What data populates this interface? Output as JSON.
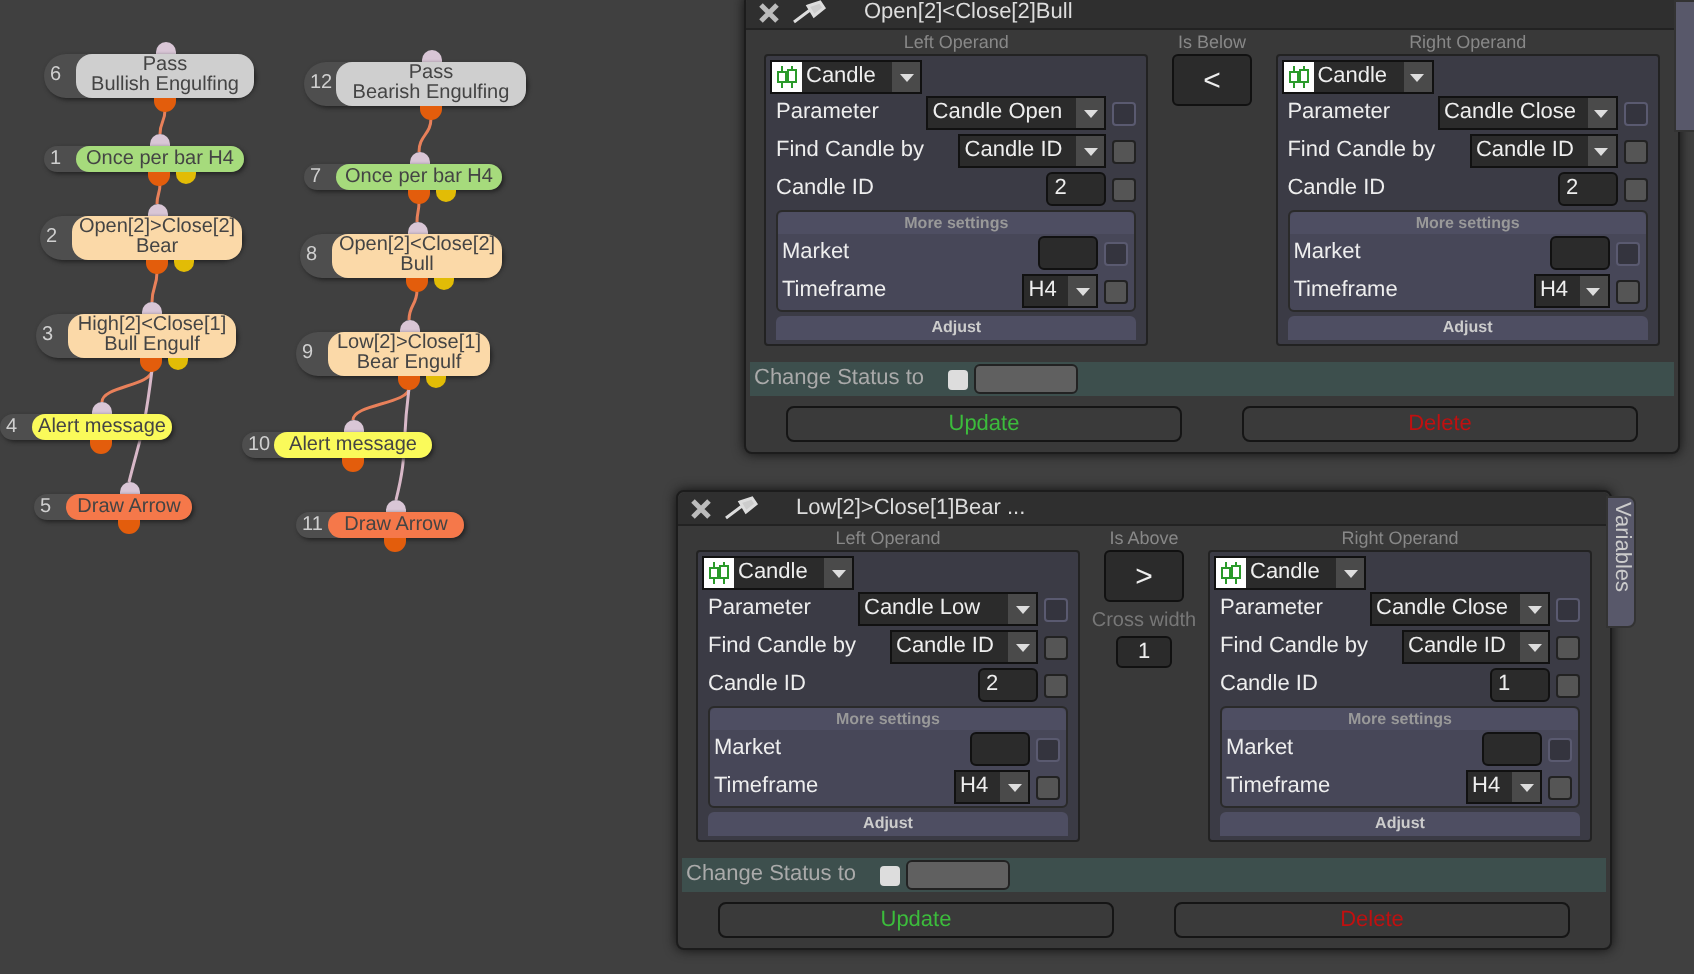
{
  "nodes": [
    {
      "number": "6",
      "kind": "pass",
      "lines": [
        "Pass",
        "Bullish Engulfing"
      ]
    },
    {
      "number": "1",
      "kind": "once",
      "lines": [
        "Once per bar H4"
      ]
    },
    {
      "number": "2",
      "kind": "condition",
      "lines": [
        "Open[2]>Close[2]",
        "Bear"
      ]
    },
    {
      "number": "3",
      "kind": "condition",
      "lines": [
        "High[2]<Close[1]",
        "Bull Engulf"
      ]
    },
    {
      "number": "4",
      "kind": "alert",
      "lines": [
        "Alert message"
      ]
    },
    {
      "number": "5",
      "kind": "arrow",
      "lines": [
        "Draw Arrow"
      ]
    },
    {
      "number": "12",
      "kind": "pass",
      "lines": [
        "Pass",
        "Bearish Engulfing"
      ]
    },
    {
      "number": "7",
      "kind": "once",
      "lines": [
        "Once per bar H4"
      ]
    },
    {
      "number": "8",
      "kind": "condition",
      "lines": [
        "Open[2]<Close[2]",
        "Bull"
      ]
    },
    {
      "number": "9",
      "kind": "condition",
      "lines": [
        "Low[2]>Close[1]",
        "Bear Engulf"
      ]
    },
    {
      "number": "10",
      "kind": "alert",
      "lines": [
        "Alert message"
      ]
    },
    {
      "number": "11",
      "kind": "arrow",
      "lines": [
        "Draw Arrow"
      ]
    }
  ],
  "dialogs": [
    {
      "title": "Open[2]<Close[2]Bull",
      "side_tab": true,
      "operator": {
        "caption": "Is Below",
        "symbol": "<"
      },
      "operands": [
        {
          "heading": "Left Operand",
          "type": "Candle",
          "rows": [
            {
              "kind": "dropdown",
              "label": "Parameter",
              "value": "Candle Open",
              "checked": false,
              "disabled": true
            },
            {
              "kind": "dropdown",
              "label": "Find Candle by",
              "value": "Candle ID",
              "checked": false,
              "disabled": false
            },
            {
              "kind": "input",
              "label": "Candle ID",
              "value": "2",
              "checked": false,
              "disabled": false
            }
          ],
          "more_settings": "More settings",
          "more_rows": [
            {
              "kind": "input",
              "label": "Market",
              "checked": false,
              "disabled": true
            },
            {
              "kind": "dropdown",
              "label": "Timeframe",
              "value": "H4",
              "checked": false,
              "disabled": false
            }
          ],
          "adjust": "Adjust"
        },
        {
          "heading": "Right Operand",
          "type": "Candle",
          "rows": [
            {
              "kind": "dropdown",
              "label": "Parameter",
              "value": "Candle Close",
              "checked": false,
              "disabled": true
            },
            {
              "kind": "dropdown",
              "label": "Find Candle by",
              "value": "Candle ID",
              "checked": false,
              "disabled": false
            },
            {
              "kind": "input",
              "label": "Candle ID",
              "value": "2",
              "checked": false,
              "disabled": false
            }
          ],
          "more_settings": "More settings",
          "more_rows": [
            {
              "kind": "input",
              "label": "Market",
              "checked": false,
              "disabled": true
            },
            {
              "kind": "dropdown",
              "label": "Timeframe",
              "value": "H4",
              "checked": false,
              "disabled": false
            }
          ],
          "adjust": "Adjust"
        }
      ],
      "status": {
        "label": "Change Status to",
        "checked": false
      },
      "buttons": [
        {
          "kind": "update",
          "label": "Update"
        },
        {
          "kind": "delete",
          "label": "Delete"
        }
      ]
    },
    {
      "title": "Low[2]>Close[1]Bear ...",
      "side_tab": true,
      "side_tab_label": "Variables",
      "operator": {
        "caption": "Is Above",
        "symbol": ">"
      },
      "cross_width": {
        "label": "Cross width",
        "value": "1"
      },
      "operands": [
        {
          "heading": "Left Operand",
          "type": "Candle",
          "rows": [
            {
              "kind": "dropdown",
              "label": "Parameter",
              "value": "Candle Low",
              "checked": false,
              "disabled": true
            },
            {
              "kind": "dropdown",
              "label": "Find Candle by",
              "value": "Candle ID",
              "checked": false,
              "disabled": false
            },
            {
              "kind": "input",
              "label": "Candle ID",
              "value": "2",
              "checked": false,
              "disabled": false
            }
          ],
          "more_settings": "More settings",
          "more_rows": [
            {
              "kind": "input",
              "label": "Market",
              "checked": false,
              "disabled": true
            },
            {
              "kind": "dropdown",
              "label": "Timeframe",
              "value": "H4",
              "checked": false,
              "disabled": false
            }
          ],
          "adjust": "Adjust"
        },
        {
          "heading": "Right Operand",
          "type": "Candle",
          "rows": [
            {
              "kind": "dropdown",
              "label": "Parameter",
              "value": "Candle Close",
              "checked": false,
              "disabled": true
            },
            {
              "kind": "dropdown",
              "label": "Find Candle by",
              "value": "Candle ID",
              "checked": false,
              "disabled": false
            },
            {
              "kind": "input",
              "label": "Candle ID",
              "value": "1",
              "checked": false,
              "disabled": false
            }
          ],
          "more_settings": "More settings",
          "more_rows": [
            {
              "kind": "input",
              "label": "Market",
              "checked": false,
              "disabled": true
            },
            {
              "kind": "dropdown",
              "label": "Timeframe",
              "value": "H4",
              "checked": false,
              "disabled": false
            }
          ],
          "adjust": "Adjust"
        }
      ],
      "status": {
        "label": "Change Status to",
        "checked": false
      },
      "buttons": [
        {
          "kind": "update",
          "label": "Update"
        },
        {
          "kind": "delete",
          "label": "Delete"
        }
      ]
    }
  ]
}
